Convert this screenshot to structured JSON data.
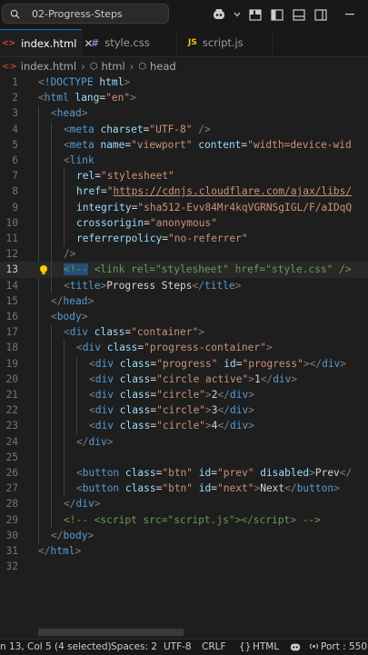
{
  "title_bar": {
    "search_text": "02-Progress-Steps",
    "icons": [
      "arrow-left-icon",
      "copilot-icon",
      "layout-icon",
      "toggle-primary-sidebar-icon",
      "toggle-panel-icon",
      "toggle-secondary-sidebar-icon",
      "minimize-icon"
    ]
  },
  "tabs": [
    {
      "label": "index.html",
      "icon": "html-file-icon",
      "active": true
    },
    {
      "label": "style.css",
      "icon": "css-file-icon",
      "active": false
    },
    {
      "label": "script.js",
      "icon": "js-file-icon",
      "active": false
    }
  ],
  "breadcrumb": [
    "index.html",
    "html",
    "head"
  ],
  "editor": {
    "line_numbers": [
      "1",
      "2",
      "3",
      "4",
      "5",
      "6",
      "7",
      "8",
      "9",
      "10",
      "11",
      "12",
      "13",
      "14",
      "15",
      "16",
      "17",
      "18",
      "19",
      "20",
      "21",
      "22",
      "23",
      "24",
      "25",
      "26",
      "27",
      "28",
      "29",
      "30",
      "31",
      "32"
    ],
    "current_line": 13
  },
  "status_bar": {
    "position": "n 13, Col 5 (4 selected)",
    "spaces": "Spaces: 2",
    "encoding": "UTF-8",
    "eol": "CRLF",
    "language_icon": "braces-icon",
    "language": "HTML",
    "copilot_icon": "copilot-icon",
    "port": "Port : 550"
  },
  "colors": {
    "background": "#1e1e1e",
    "tag": "#569cd6",
    "attribute": "#9cdcfe",
    "string": "#ce9178",
    "comment": "#6a9955",
    "text": "#d4d4d4"
  }
}
